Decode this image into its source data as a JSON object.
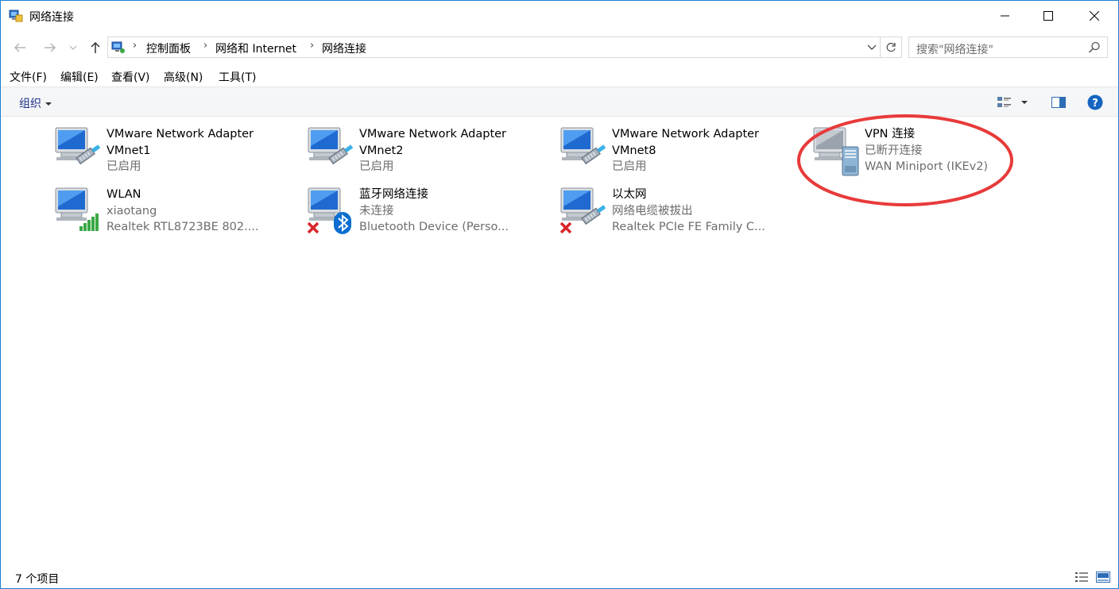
{
  "window": {
    "title": "网络连接"
  },
  "address": {
    "crumbs": [
      "控制面板",
      "网络和 Internet",
      "网络连接"
    ]
  },
  "search": {
    "placeholder": "搜索\"网络连接\""
  },
  "menu": {
    "items": [
      "文件(F)",
      "编辑(E)",
      "查看(V)",
      "高级(N)",
      "工具(T)"
    ]
  },
  "command": {
    "organize": "组织"
  },
  "connections": [
    {
      "name": "VMware Network Adapter",
      "line2": "VMnet1",
      "line3": "已启用",
      "icon": "wired-adapter-icon"
    },
    {
      "name": "VMware Network Adapter",
      "line2": "VMnet2",
      "line3": "已启用",
      "icon": "wired-adapter-icon"
    },
    {
      "name": "VMware Network Adapter",
      "line2": "VMnet8",
      "line3": "已启用",
      "icon": "wired-adapter-icon"
    },
    {
      "name": "VPN 连接",
      "line2": "已断开连接",
      "line3": "WAN Miniport (IKEv2)",
      "icon": "vpn-icon"
    },
    {
      "name": "WLAN",
      "line2": "xiaotang",
      "line3": "Realtek RTL8723BE 802....",
      "icon": "wifi-adapter-icon"
    },
    {
      "name": "蓝牙网络连接",
      "line2": "未连接",
      "line3": "Bluetooth Device (Perso...",
      "icon": "bluetooth-adapter-icon"
    },
    {
      "name": "以太网",
      "line2": "网络电缆被拔出",
      "line3": "Realtek PCIe FE Family C...",
      "icon": "ethernet-unplugged-icon"
    }
  ],
  "status": {
    "count": "7 个项目"
  },
  "colors": {
    "accent": "#1a7fd4",
    "annotation": "#e83a3a",
    "help": "#1565c0"
  }
}
